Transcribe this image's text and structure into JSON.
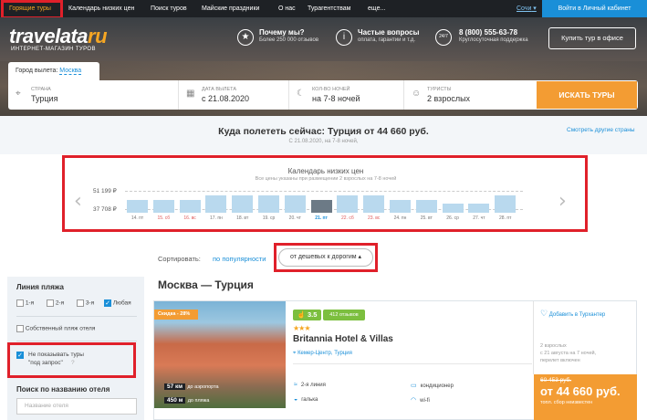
{
  "topnav": {
    "items": [
      "Горящие туры",
      "Календарь низких цен",
      "Поиск туров",
      "Майские праздники",
      "О нас",
      "Турагентствам",
      "еще..."
    ],
    "city": "Сочи",
    "login": "Войти в Личный кабинет"
  },
  "hero": {
    "logo_main": "travelata",
    "logo_ru": "ru",
    "logo_sub": "ИНТЕРНЕТ-МАГАЗИН ТУРОВ",
    "features": [
      {
        "title": "Почему мы?",
        "sub": "Более 250 000 отзывов"
      },
      {
        "title": "Частые вопросы",
        "sub": "оплата, гарантии и т.д."
      },
      {
        "title": "8 (800) 555-63-78",
        "sub": "Круглосуточная поддержка"
      }
    ],
    "phone_badge": "24/7",
    "buy_office": "Купить тур в офисе"
  },
  "search": {
    "city_label": "Город вылета:",
    "city_value": "Москва",
    "country_label": "СТРАНА",
    "country_value": "Турция",
    "date_label": "ДАТА ВЫЛЕТА",
    "date_value": "с 21.08.2020",
    "nights_label": "КОЛ-ВО НОЧЕЙ",
    "nights_value": "на 7-8 ночей",
    "tourists_label": "ТУРИСТЫ",
    "tourists_value": "2 взрослых",
    "button": "ИСКАТЬ ТУРЫ"
  },
  "where": {
    "title": "Куда полететь сейчас: Турция от 44 660 руб.",
    "sub": "С 21.08.2020, на 7-8 ночей,",
    "other": "Смотреть другие страны"
  },
  "calendar": {
    "title": "Календарь низких цен",
    "sub": "Все цены указаны при размещении 2 взрослых на 7-8 ночей",
    "max_price": "51 199 ₽",
    "min_price": "37 708 ₽",
    "days": [
      {
        "label": "14. пт",
        "level": 0.35,
        "weekend": false,
        "selected": false
      },
      {
        "label": "15. сб",
        "level": 0.35,
        "weekend": true,
        "selected": false
      },
      {
        "label": "16. вс",
        "level": 0.35,
        "weekend": true,
        "selected": false
      },
      {
        "label": "17. пн",
        "level": 0.7,
        "weekend": false,
        "selected": false
      },
      {
        "label": "18. вт",
        "level": 0.7,
        "weekend": false,
        "selected": false
      },
      {
        "label": "19. ср",
        "level": 0.7,
        "weekend": false,
        "selected": false
      },
      {
        "label": "20. чт",
        "level": 0.7,
        "weekend": false,
        "selected": false
      },
      {
        "label": "21. пт",
        "level": 0.4,
        "weekend": false,
        "selected": true
      },
      {
        "label": "22. сб",
        "level": 0.7,
        "weekend": true,
        "selected": false
      },
      {
        "label": "23. вс",
        "level": 0.7,
        "weekend": true,
        "selected": false
      },
      {
        "label": "24. пн",
        "level": 0.35,
        "weekend": false,
        "selected": false
      },
      {
        "label": "25. вт",
        "level": 0.35,
        "weekend": false,
        "selected": false
      },
      {
        "label": "26. ср",
        "level": 0.1,
        "weekend": false,
        "selected": false
      },
      {
        "label": "27. чт",
        "level": 0.1,
        "weekend": false,
        "selected": false
      },
      {
        "label": "28. пт",
        "level": 0.7,
        "weekend": false,
        "selected": false
      }
    ]
  },
  "sort": {
    "label": "Сортировать:",
    "popular": "по популярности",
    "cheap": "от дешевых к дорогим"
  },
  "filters": {
    "beach_title": "Линия пляжа",
    "beach_options": [
      "1-я",
      "2-я",
      "3-я",
      "Любая"
    ],
    "own_beach": "Собственный пляж отеля",
    "no_request_1": "Не показывать туры",
    "no_request_2": "\"под запрос\"",
    "name_title": "Поиск по названию отеля",
    "name_placeholder": "Название отеля"
  },
  "results": {
    "title": "Москва — Турция",
    "hotel": {
      "discount": "Скидка - 28%",
      "rating": "3.5",
      "reviews": "412 отзывов",
      "stars": "★★★",
      "name": "Britannia Hotel & Villas",
      "location": "Кемер-Центр, Турция",
      "dist_airport_val": "57 км",
      "dist_airport": "до аэропорта",
      "dist_beach_val": "450 м",
      "dist_beach": "до пляжа",
      "amenities": [
        "2-я линия",
        "кондиционер",
        "галька",
        "wi-fi"
      ],
      "favorite": "Добавить в Турхантер",
      "info": [
        "2 взрослых",
        "с 21 августа на 7 ночей,",
        "перелет включен"
      ],
      "old_price": "60 453 руб.",
      "price": "от 44 660 руб.",
      "price_note": "топл. сбор неизвестен"
    }
  }
}
